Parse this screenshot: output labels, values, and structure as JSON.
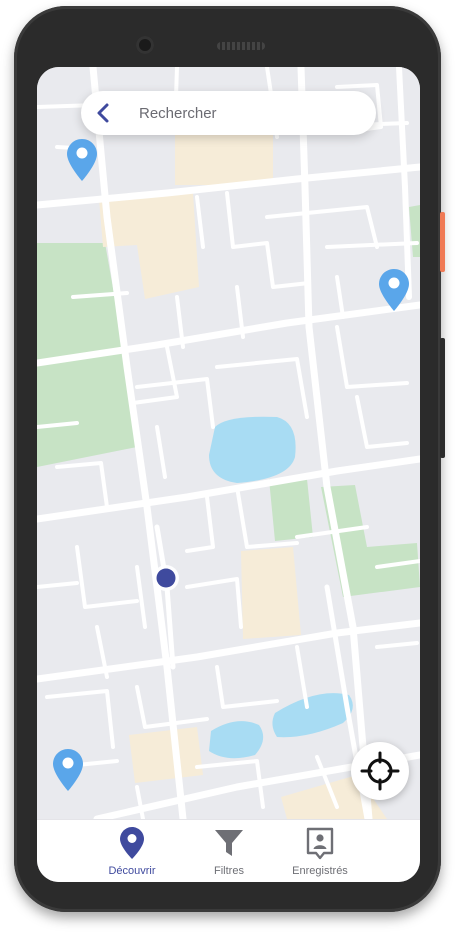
{
  "search": {
    "placeholder": "Rechercher"
  },
  "bottom_nav": {
    "items": [
      {
        "label": "Découvrir",
        "icon": "map-pin-icon",
        "active": true
      },
      {
        "label": "Filtres",
        "icon": "filter-icon",
        "active": false
      },
      {
        "label": "Enregistrés",
        "icon": "saved-profile-icon",
        "active": false
      }
    ]
  },
  "colors": {
    "accent": "#3f4a9e",
    "pin": "#5aa6ea",
    "park": "#c7e3c5",
    "water": "#a8dcf3",
    "building": "#f6ecd8",
    "road": "#ffffff",
    "ground": "#e9eaee"
  }
}
